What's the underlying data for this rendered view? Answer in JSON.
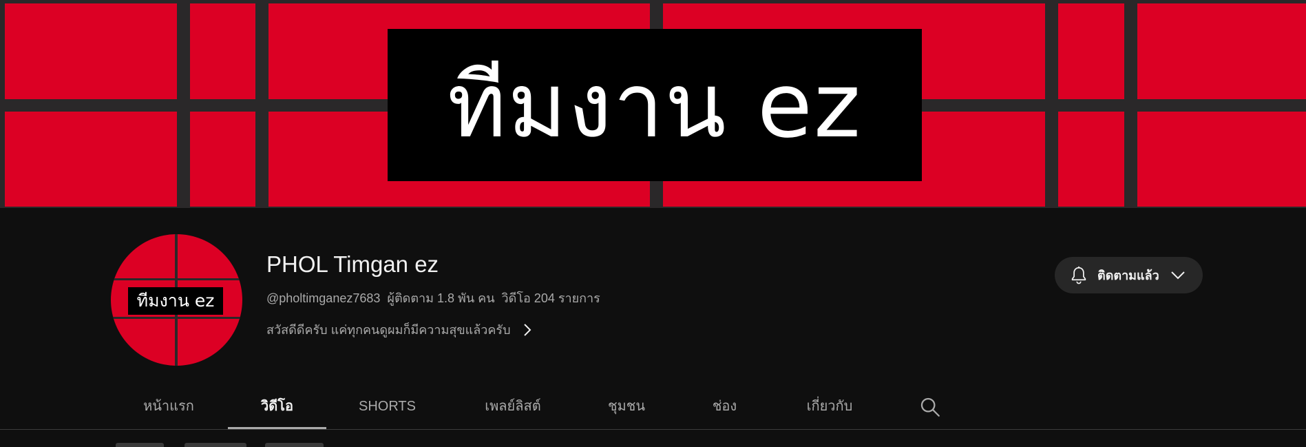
{
  "banner": {
    "title": "ทีมงาน ez",
    "background_color": "#dc0024",
    "grid_color": "#2a2829"
  },
  "channel": {
    "avatar_label": "ทีมงาน ez",
    "name": "PHOL Timgan ez",
    "handle": "@pholtimganez7683",
    "subscribers": "ผู้ติดตาม 1.8 พัน คน",
    "videos": "วิดีโอ 204 รายการ",
    "description": "สวัสดีดีครับ แค่ทุกคนดูผมก็มีความสุขแล้วครับ"
  },
  "subscribe_button": {
    "label": "ติดตามแล้ว",
    "icon": "bell-icon"
  },
  "tabs": [
    {
      "label": "หน้าแรก",
      "active": false
    },
    {
      "label": "วิดีโอ",
      "active": true
    },
    {
      "label": "SHORTS",
      "active": false
    },
    {
      "label": "เพลย์ลิสต์",
      "active": false
    },
    {
      "label": "ชุมชน",
      "active": false
    },
    {
      "label": "ช่อง",
      "active": false
    },
    {
      "label": "เกี่ยวกับ",
      "active": false
    }
  ],
  "colors": {
    "page_bg": "#0f0f0f",
    "text_primary": "#f1f1f1",
    "text_secondary": "#aaaaaa",
    "button_bg": "#272727"
  }
}
